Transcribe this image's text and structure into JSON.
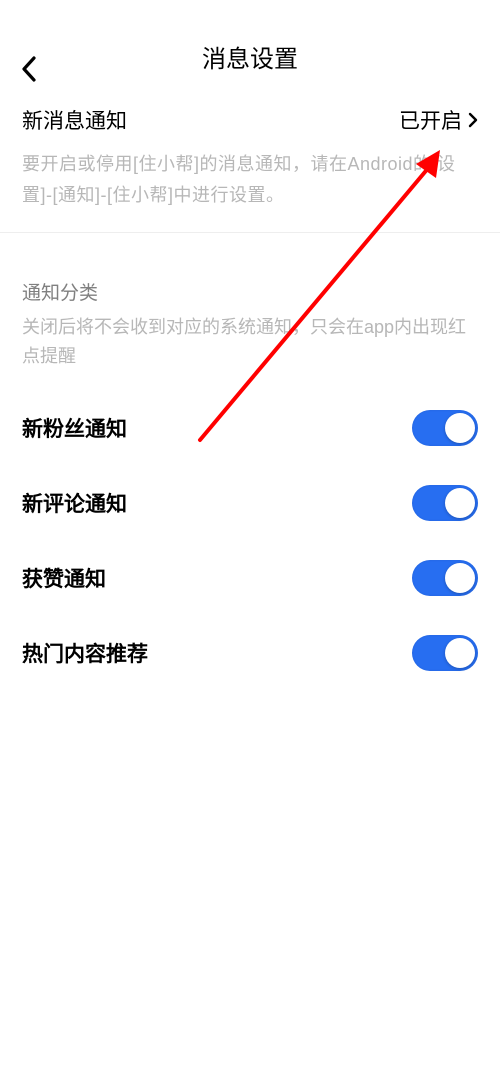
{
  "header": {
    "title": "消息设置"
  },
  "notification": {
    "label": "新消息通知",
    "status": "已开启",
    "desc": "要开启或停用[住小帮]的消息通知，请在Android的[设置]-[通知]-[住小帮]中进行设置。"
  },
  "category": {
    "title": "通知分类",
    "desc": "关闭后将不会收到对应的系统通知，只会在app内出现红点提醒"
  },
  "toggles": [
    {
      "label": "新粉丝通知",
      "on": true
    },
    {
      "label": "新评论通知",
      "on": true
    },
    {
      "label": "获赞通知",
      "on": true
    },
    {
      "label": "热门内容推荐",
      "on": true
    }
  ]
}
